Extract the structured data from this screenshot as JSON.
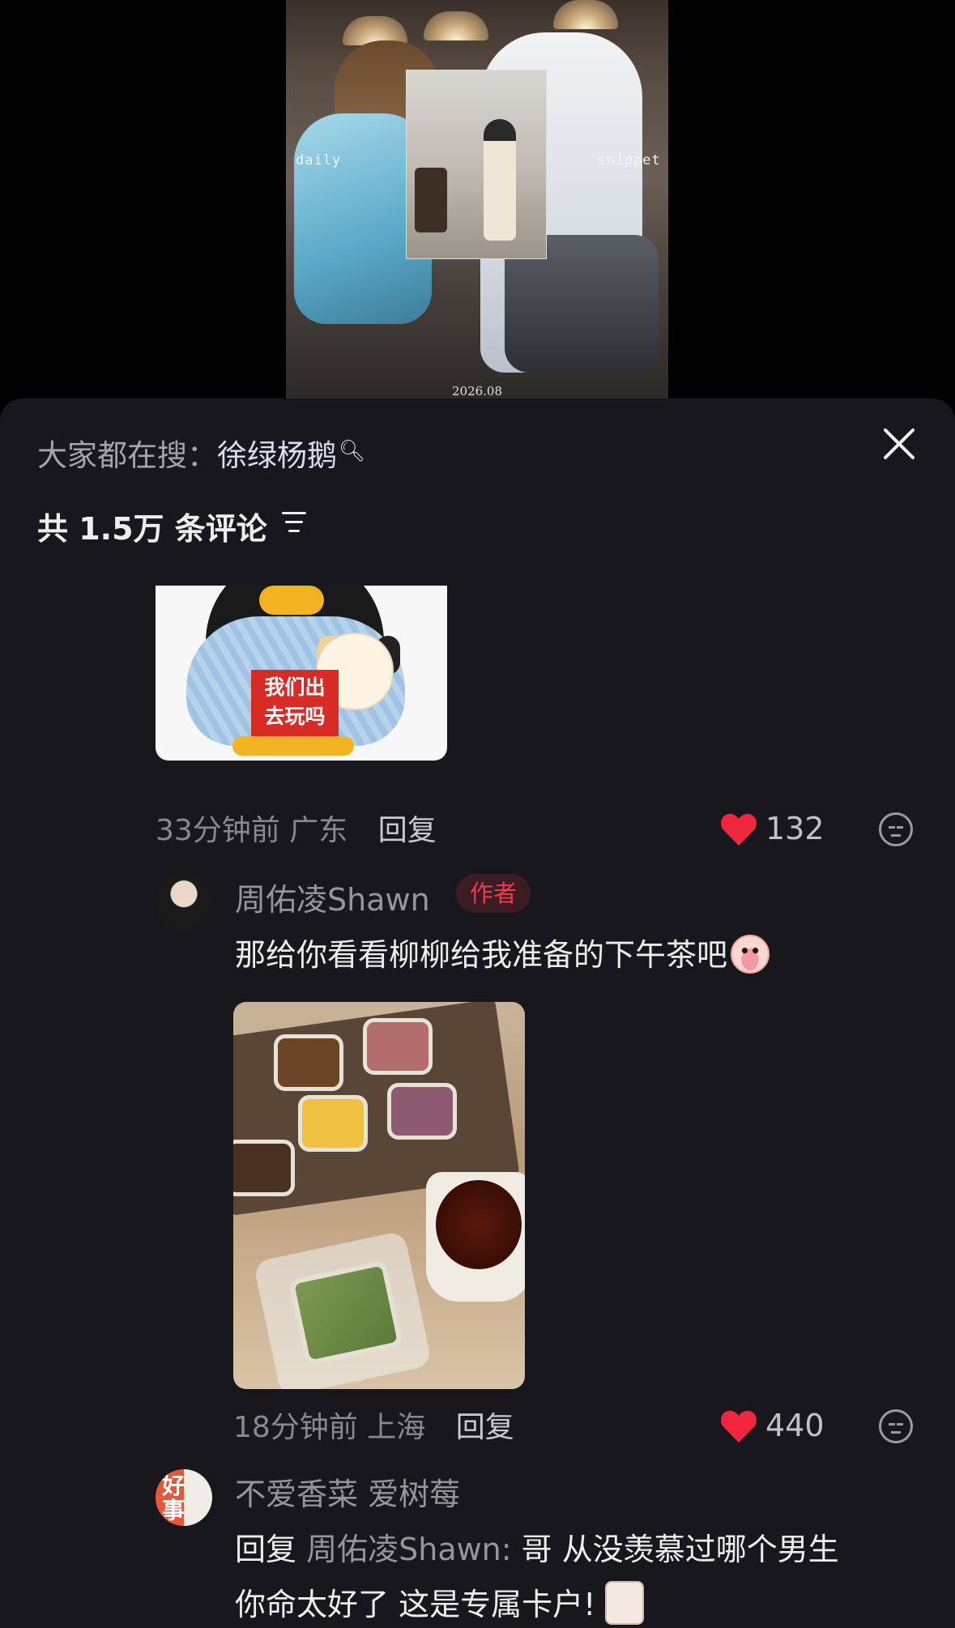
{
  "video": {
    "overlay_left": "daily",
    "overlay_right": "snippet",
    "date": "2026.08"
  },
  "panel": {
    "search_prefix": "大家都在搜：",
    "search_keyword": "徐绿杨鹅",
    "comment_count": "共 1.5万 条评论"
  },
  "comments": [
    {
      "sticker_text_line1": "我们出",
      "sticker_text_line2": "去玩吗",
      "time": "33分钟前",
      "location": "广东",
      "reply_label": "回复",
      "likes": "132"
    },
    {
      "author": "周佑凌Shawn",
      "badge": "作者",
      "text": "那给你看看柳柳给我准备的下午茶吧",
      "time": "18分钟前",
      "location": "上海",
      "reply_label": "回复",
      "likes": "440"
    },
    {
      "author": "不爱香菜 爱树莓",
      "avatar_text": "好事",
      "reply_prefix": "回复",
      "reply_target": "周佑凌Shawn:",
      "text_line1": "哥 从没羡慕过哪个男生",
      "text_line2": "你命太好了 这是专属卡户!"
    }
  ],
  "colors": {
    "panel_bg": "#18171d",
    "heart": "#f0263f",
    "author_badge_text": "#f03a4f"
  }
}
